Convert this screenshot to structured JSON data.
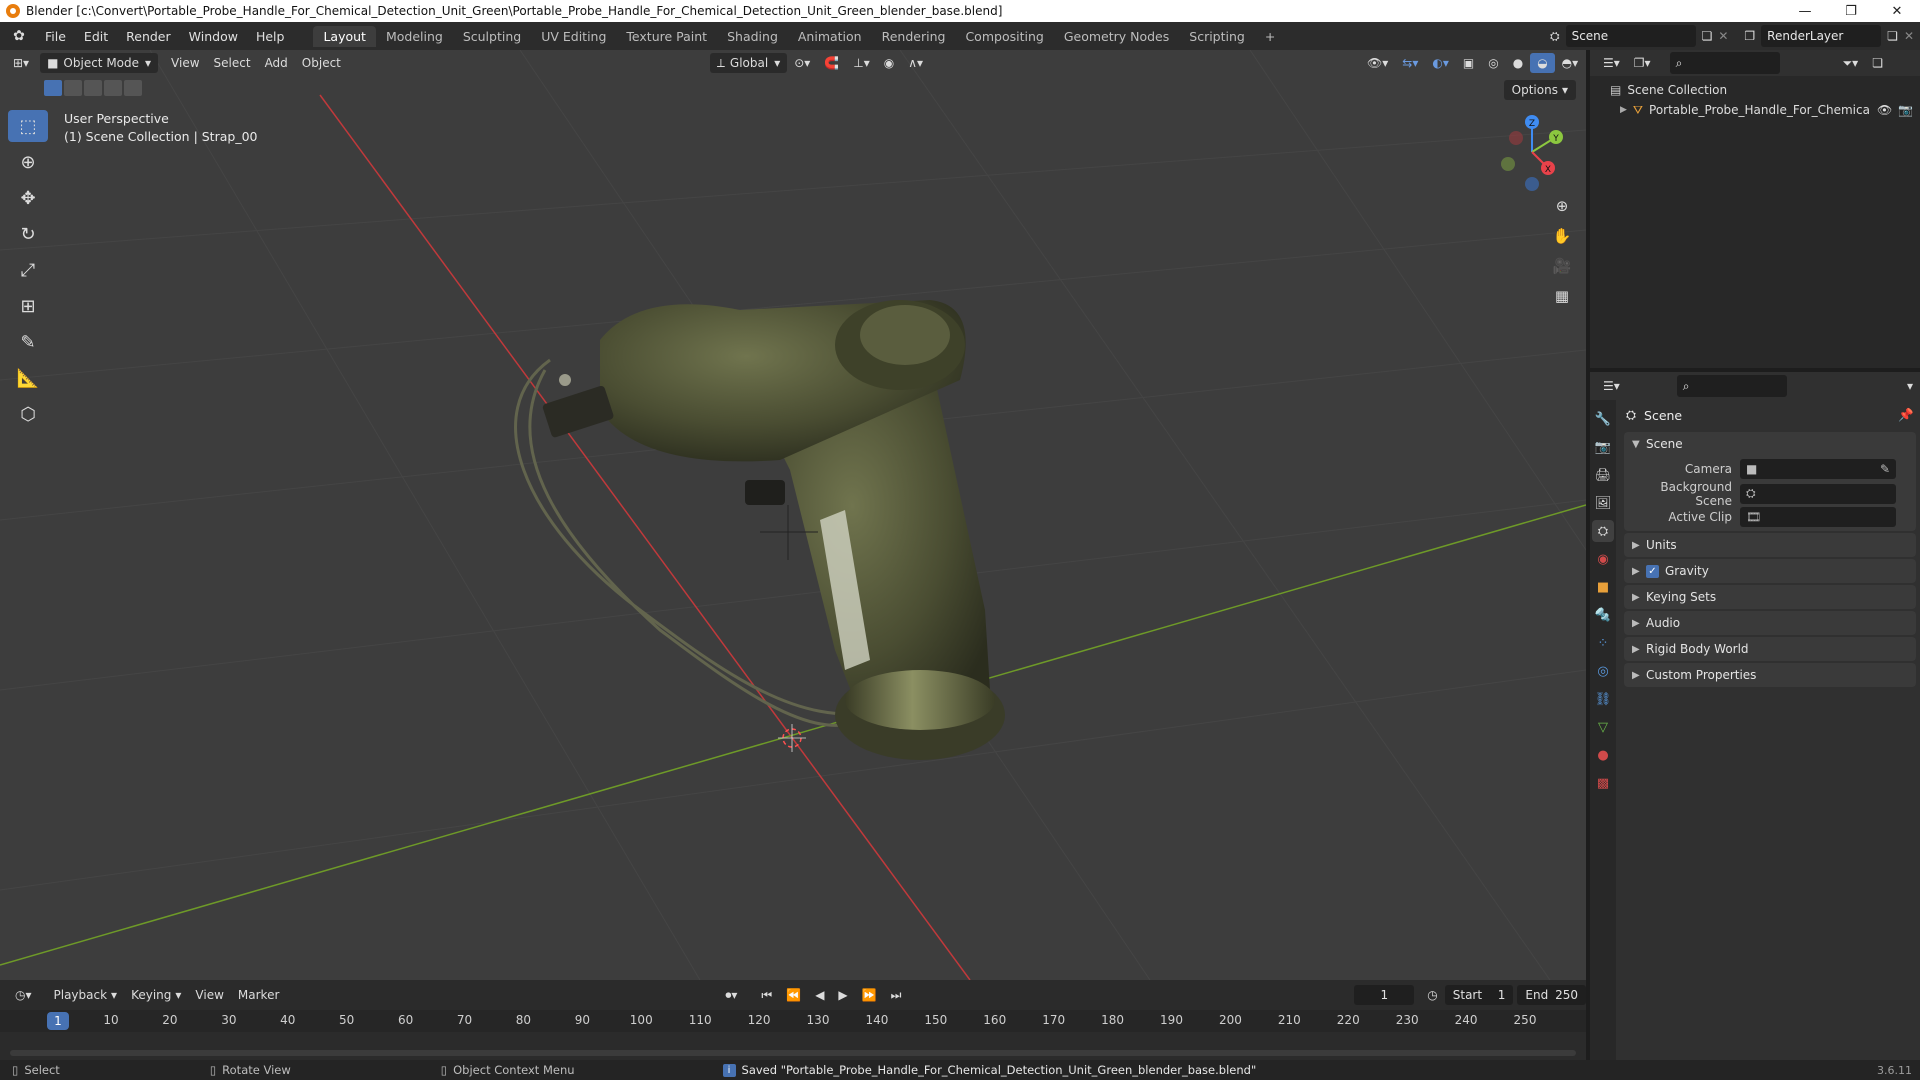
{
  "window": {
    "title": "Blender [c:\\Convert\\Portable_Probe_Handle_For_Chemical_Detection_Unit_Green\\Portable_Probe_Handle_For_Chemical_Detection_Unit_Green_blender_base.blend]",
    "minimize": "—",
    "maximize": "❐",
    "close": "✕"
  },
  "menu": {
    "items": [
      "File",
      "Edit",
      "Render",
      "Window",
      "Help"
    ],
    "workspaces": [
      "Layout",
      "Modeling",
      "Sculpting",
      "UV Editing",
      "Texture Paint",
      "Shading",
      "Animation",
      "Rendering",
      "Compositing",
      "Geometry Nodes",
      "Scripting",
      "+"
    ],
    "active_workspace": "Layout",
    "scene": "Scene",
    "view_layer": "RenderLayer"
  },
  "viewport_header": {
    "mode": "Object Mode",
    "menus": [
      "View",
      "Select",
      "Add",
      "Object"
    ],
    "orientation": "Global",
    "options": "Options"
  },
  "viewport": {
    "perspective": "User Perspective",
    "context": "(1) Scene Collection | Strap_00",
    "gizmo_axes": {
      "x": "X",
      "y": "Y",
      "z": "Z"
    }
  },
  "colors": {
    "accent": "#4772b3",
    "grid_x": "#c0393b",
    "grid_y": "#6e9a28",
    "object": "#4e5236",
    "header_bg": "#2c2c2c",
    "viewport_bg": "#3d3d3d"
  },
  "timeline": {
    "menus": [
      "Playback",
      "Keying",
      "View",
      "Marker"
    ],
    "current_frame": "1",
    "start_label": "Start",
    "start": "1",
    "end_label": "End",
    "end": "250",
    "ticks": [
      "1",
      "10",
      "20",
      "30",
      "40",
      "50",
      "60",
      "70",
      "80",
      "90",
      "100",
      "110",
      "120",
      "130",
      "140",
      "150",
      "160",
      "170",
      "180",
      "190",
      "200",
      "210",
      "220",
      "230",
      "240",
      "250"
    ]
  },
  "statusbar": {
    "select": "Select",
    "rotate": "Rotate View",
    "context_menu": "Object Context Menu",
    "message": "Saved \"Portable_Probe_Handle_For_Chemical_Detection_Unit_Green_blender_base.blend\"",
    "version": "3.6.11"
  },
  "outliner": {
    "collection": "Scene Collection",
    "object": "Portable_Probe_Handle_For_Chemical_D"
  },
  "properties": {
    "header": "Scene",
    "panel_scene": "Scene",
    "camera_label": "Camera",
    "background_label": "Background Scene",
    "clip_label": "Active Clip",
    "panels": [
      "Units",
      "Gravity",
      "Keying Sets",
      "Audio",
      "Rigid Body World",
      "Custom Properties"
    ]
  }
}
